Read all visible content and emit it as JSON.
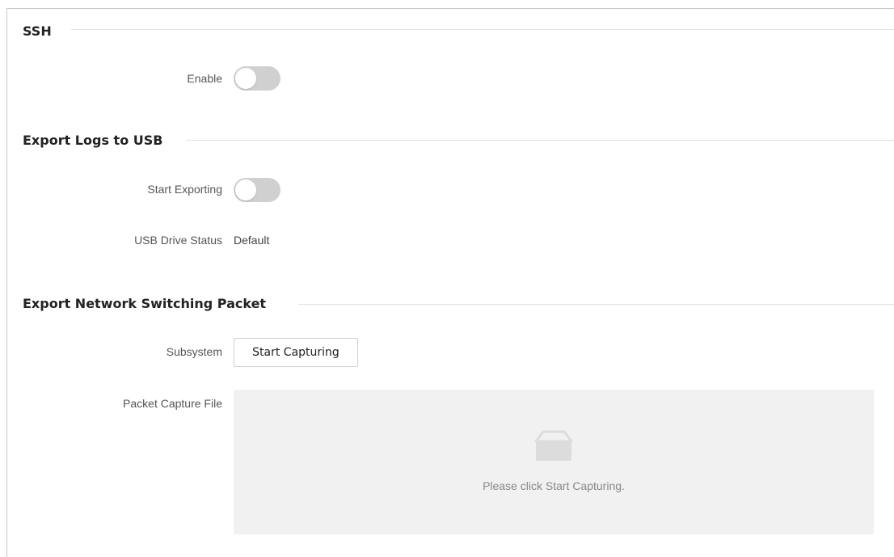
{
  "ssh": {
    "title": "SSH",
    "enable_label": "Enable",
    "enable_state": "off"
  },
  "export_logs": {
    "title": "Export Logs to USB",
    "start_exporting_label": "Start Exporting",
    "start_exporting_state": "off",
    "usb_status_label": "USB Drive Status",
    "usb_status_value": "Default"
  },
  "export_packet": {
    "title": "Export Network Switching Packet",
    "subsystem_label": "Subsystem",
    "start_capturing_button": "Start Capturing",
    "capture_file_label": "Packet Capture File",
    "empty_message": "Please click Start Capturing.",
    "empty_icon": "empty-box-icon"
  },
  "colors": {
    "toggle_off": "#d0d0d0",
    "capture_area_bg": "#f1f1f1",
    "empty_icon": "#dcdcdc"
  }
}
